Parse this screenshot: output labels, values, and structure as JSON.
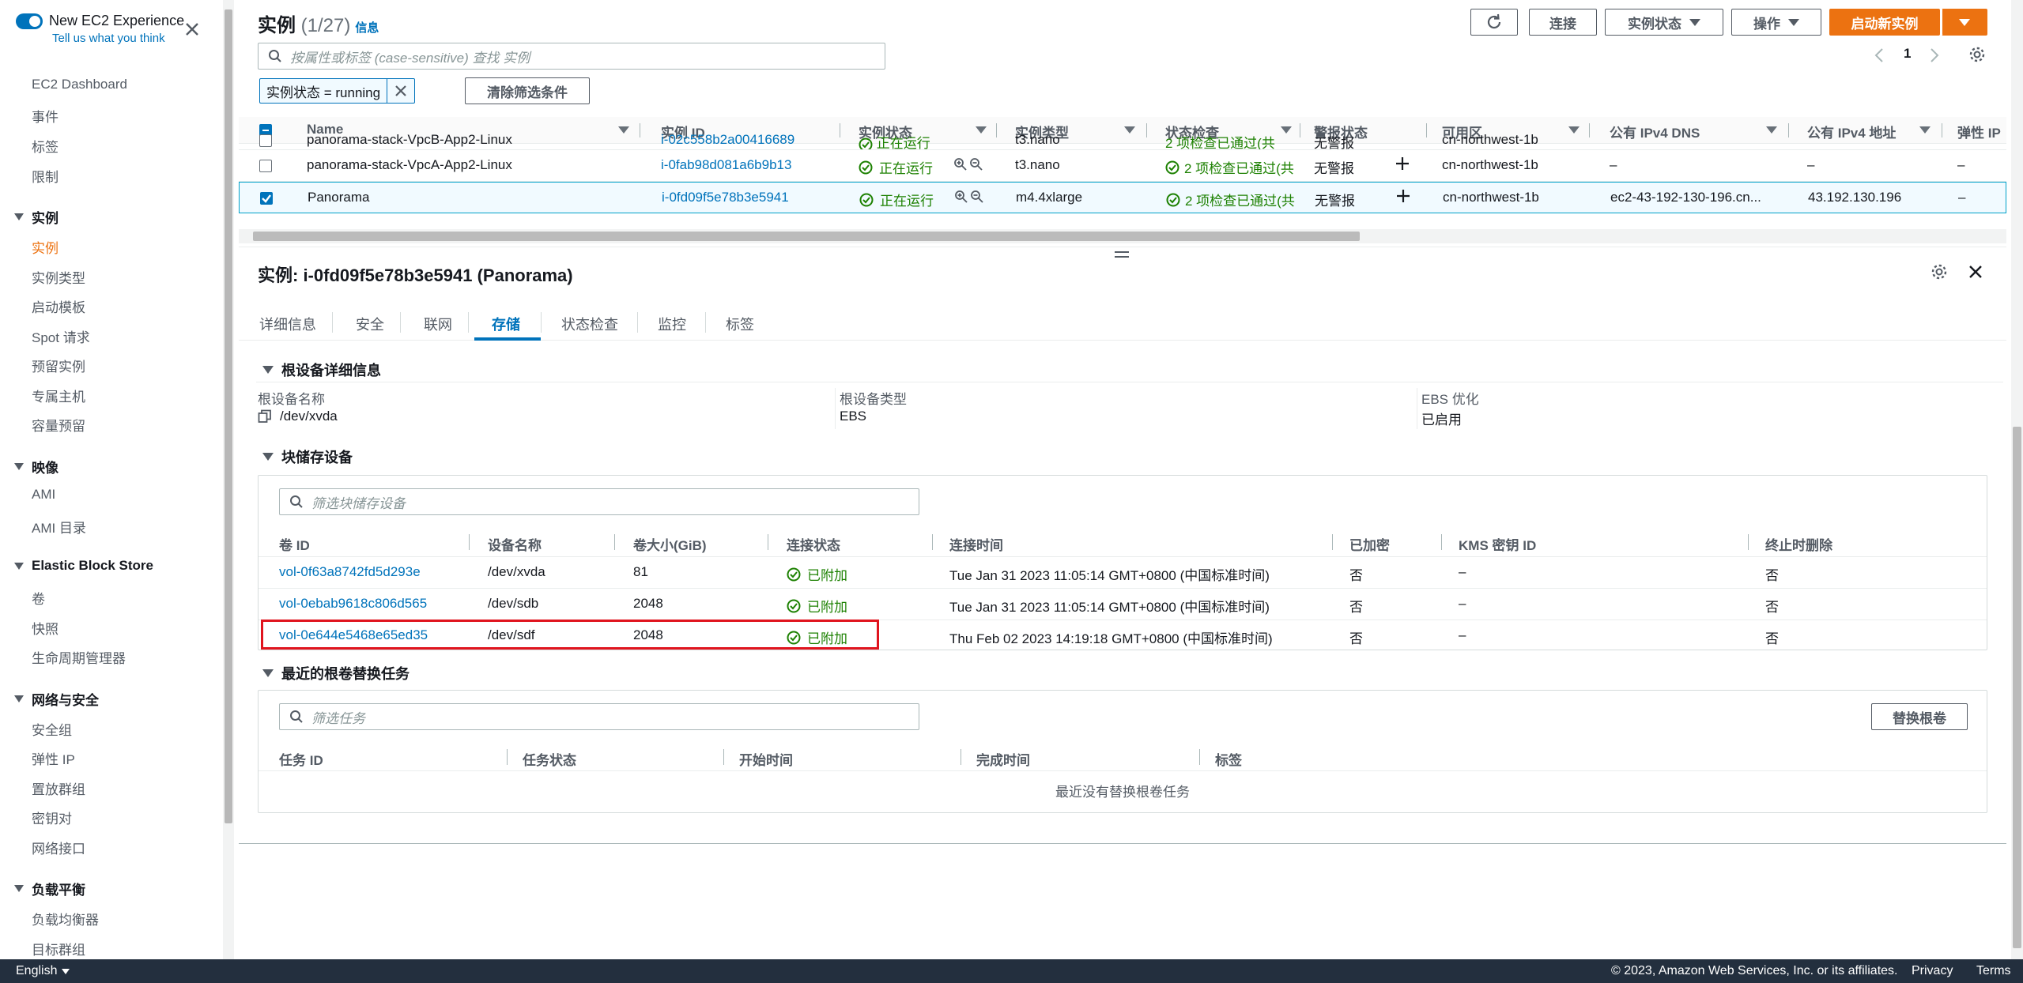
{
  "sidebar": {
    "new_exp_title": "New EC2 Experience",
    "new_exp_link": "Tell us what you think",
    "top_items": [
      "EC2 Dashboard",
      "事件",
      "标签",
      "限制"
    ],
    "groups": [
      {
        "title": "实例",
        "items": [
          "实例",
          "实例类型",
          "启动模板",
          "Spot 请求",
          "预留实例",
          "专属主机",
          "容量预留"
        ]
      },
      {
        "title": "映像",
        "items": [
          "AMI",
          "AMI 目录"
        ]
      },
      {
        "title": "Elastic Block Store",
        "items": [
          "卷",
          "快照",
          "生命周期管理器"
        ]
      },
      {
        "title": "网络与安全",
        "items": [
          "安全组",
          "弹性 IP",
          "置放群组",
          "密钥对",
          "网络接口"
        ]
      },
      {
        "title": "负载平衡",
        "items": [
          "负载均衡器",
          "目标群组"
        ]
      }
    ],
    "active_item": "实例"
  },
  "header": {
    "title": "实例",
    "count": "(1/27)",
    "info": "信息",
    "refresh_icon": "refresh-icon",
    "connect": "连接",
    "instance_state": "实例状态",
    "actions": "操作",
    "launch": "启动新实例",
    "search_placeholder": "按属性或标签 (case-sensitive) 查找 实例",
    "filter_token": "实例状态 = running",
    "clear_filters": "清除筛选条件",
    "page": "1"
  },
  "instances": {
    "columns": [
      "Name",
      "实例 ID",
      "实例状态",
      "实例类型",
      "状态检查",
      "警报状态",
      "可用区",
      "公有 IPv4 DNS",
      "公有 IPv4 地址",
      "弹性 IP"
    ],
    "rows": [
      {
        "name": "panorama-stack-VpcB-App2-Linux",
        "id": "i-02c558b2a00416689",
        "state": "正在运行",
        "type": "t3.nano",
        "check": "2 项检查已通过(共",
        "alarm": "无警报",
        "az": "cn-northwest-1b",
        "dns": "–",
        "ip": "–",
        "eip": "–",
        "selected": false
      },
      {
        "name": "panorama-stack-VpcA-App2-Linux",
        "id": "i-0fab98d081a6b9b13",
        "state": "正在运行",
        "type": "t3.nano",
        "check": "2 项检查已通过(共",
        "alarm": "无警报",
        "az": "cn-northwest-1b",
        "dns": "–",
        "ip": "–",
        "eip": "–",
        "selected": false
      },
      {
        "name": "Panorama",
        "id": "i-0fd09f5e78b3e5941",
        "state": "正在运行",
        "type": "m4.4xlarge",
        "check": "2 项检查已通过(共",
        "alarm": "无警报",
        "az": "cn-northwest-1b",
        "dns": "ec2-43-192-130-196.cn...",
        "ip": "43.192.130.196",
        "eip": "–",
        "selected": true
      }
    ]
  },
  "detail": {
    "title": "实例: i-0fd09f5e78b3e5941 (Panorama)",
    "tabs": [
      "详细信息",
      "安全",
      "联网",
      "存储",
      "状态检查",
      "监控",
      "标签"
    ],
    "active_tab": "存储",
    "root_section": "根设备详细信息",
    "root_name_label": "根设备名称",
    "root_name": "/dev/xvda",
    "root_type_label": "根设备类型",
    "root_type": "EBS",
    "ebs_opt_label": "EBS 优化",
    "ebs_opt": "已启用",
    "block_section": "块储存设备",
    "block_placeholder": "筛选块储存设备",
    "block_columns": [
      "卷 ID",
      "设备名称",
      "卷大小(GiB)",
      "连接状态",
      "连接时间",
      "已加密",
      "KMS 密钥 ID",
      "终止时删除"
    ],
    "block_rows": [
      {
        "vol": "vol-0f63a8742fd5d293e",
        "dev": "/dev/xvda",
        "size": "81",
        "status": "已附加",
        "time": "Tue Jan 31 2023 11:05:14 GMT+0800 (中国标准时间)",
        "enc": "否",
        "kms": "–",
        "del": "否"
      },
      {
        "vol": "vol-0ebab9618c806d565",
        "dev": "/dev/sdb",
        "size": "2048",
        "status": "已附加",
        "time": "Tue Jan 31 2023 11:05:14 GMT+0800 (中国标准时间)",
        "enc": "否",
        "kms": "–",
        "del": "否"
      },
      {
        "vol": "vol-0e644e5468e65ed35",
        "dev": "/dev/sdf",
        "size": "2048",
        "status": "已附加",
        "time": "Thu Feb 02 2023 14:19:18 GMT+0800 (中国标准时间)",
        "enc": "否",
        "kms": "–",
        "del": "否"
      }
    ],
    "replace_section": "最近的根卷替换任务",
    "task_placeholder": "筛选任务",
    "replace_button": "替换根卷",
    "task_columns": [
      "任务 ID",
      "任务状态",
      "开始时间",
      "完成时间",
      "标签"
    ],
    "task_empty": "最近没有替换根卷任务"
  },
  "footer": {
    "language": "English",
    "copyright": "© 2023, Amazon Web Services, Inc. or its affiliates.",
    "privacy": "Privacy",
    "terms": "Terms"
  },
  "colors": {
    "accent": "#0073bb",
    "primary": "#ec7211",
    "success": "#1d8102",
    "highlight": "#e0141e"
  }
}
